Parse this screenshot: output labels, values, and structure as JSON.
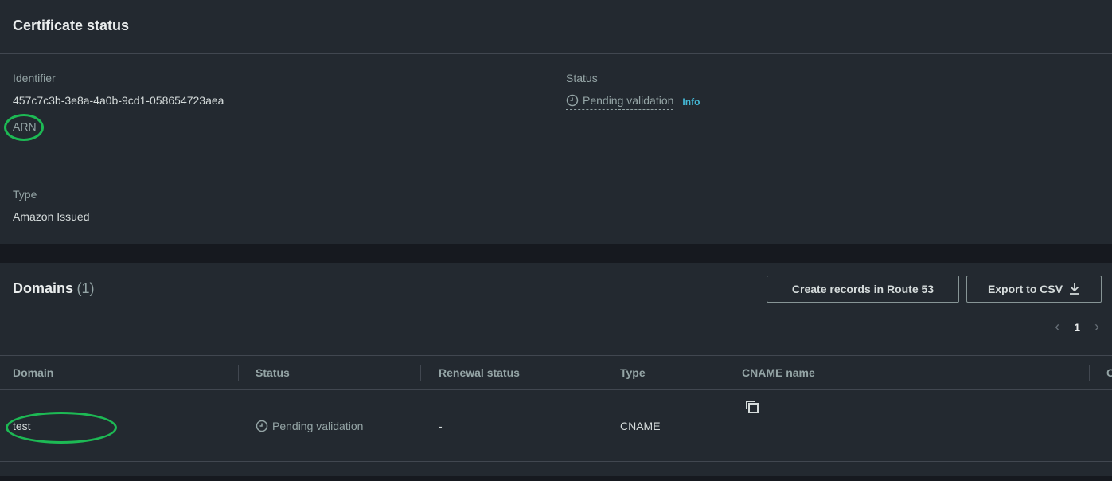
{
  "certificate_status": {
    "title": "Certificate status",
    "identifier_label": "Identifier",
    "identifier_value": "457c7c3b-3e8a-4a0b-9cd1-058654723aea",
    "arn_label": "ARN",
    "status_label": "Status",
    "status_value": "Pending validation",
    "info_link": "Info",
    "type_label": "Type",
    "type_value": "Amazon Issued"
  },
  "domains": {
    "title": "Domains",
    "count": "(1)",
    "create_records_button": "Create records in Route 53",
    "export_button": "Export to CSV",
    "pagination": {
      "current_page": "1"
    },
    "columns": [
      "Domain",
      "Status",
      "Renewal status",
      "Type",
      "CNAME name",
      "C"
    ],
    "rows": [
      {
        "domain": "test",
        "status": "Pending validation",
        "renewal_status": "-",
        "type": "CNAME"
      }
    ]
  },
  "colors": {
    "background": "#16191f",
    "panel": "#232930",
    "accent_link": "#44b9d6",
    "highlight_oval": "#1db954"
  }
}
